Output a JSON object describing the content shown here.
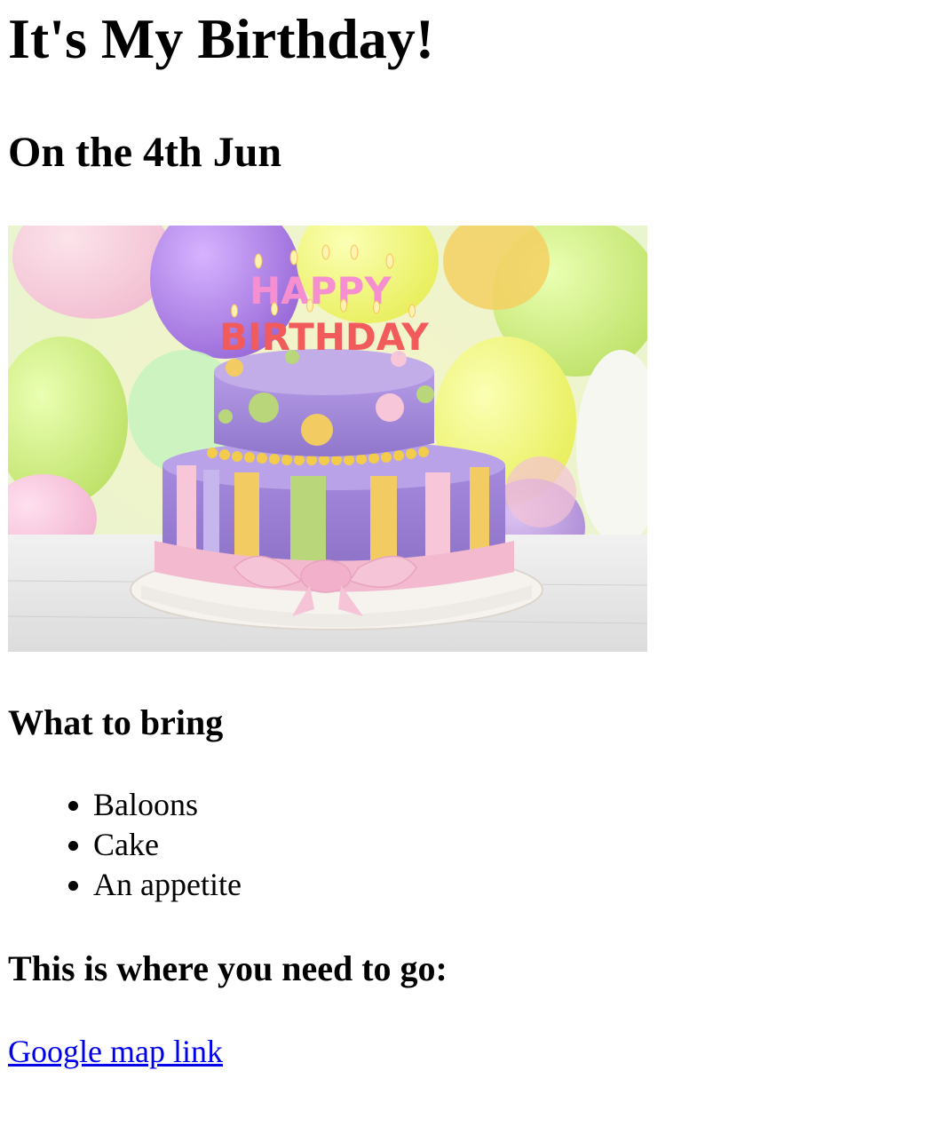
{
  "page": {
    "title": "It's My Birthday!",
    "date_heading": "On the 4th Jun",
    "image": {
      "alt": "Birthday cake with Happy Birthday candles",
      "candle_text_line1": "HAPPY",
      "candle_text_line2": "BIRTHDAY"
    },
    "bring_heading": "What to bring",
    "bring_items": [
      "Baloons",
      "Cake",
      "An appetite"
    ],
    "where_heading": "This is where you need to go:",
    "map_link_text": "Google map link",
    "link_color": "#0000ee"
  }
}
